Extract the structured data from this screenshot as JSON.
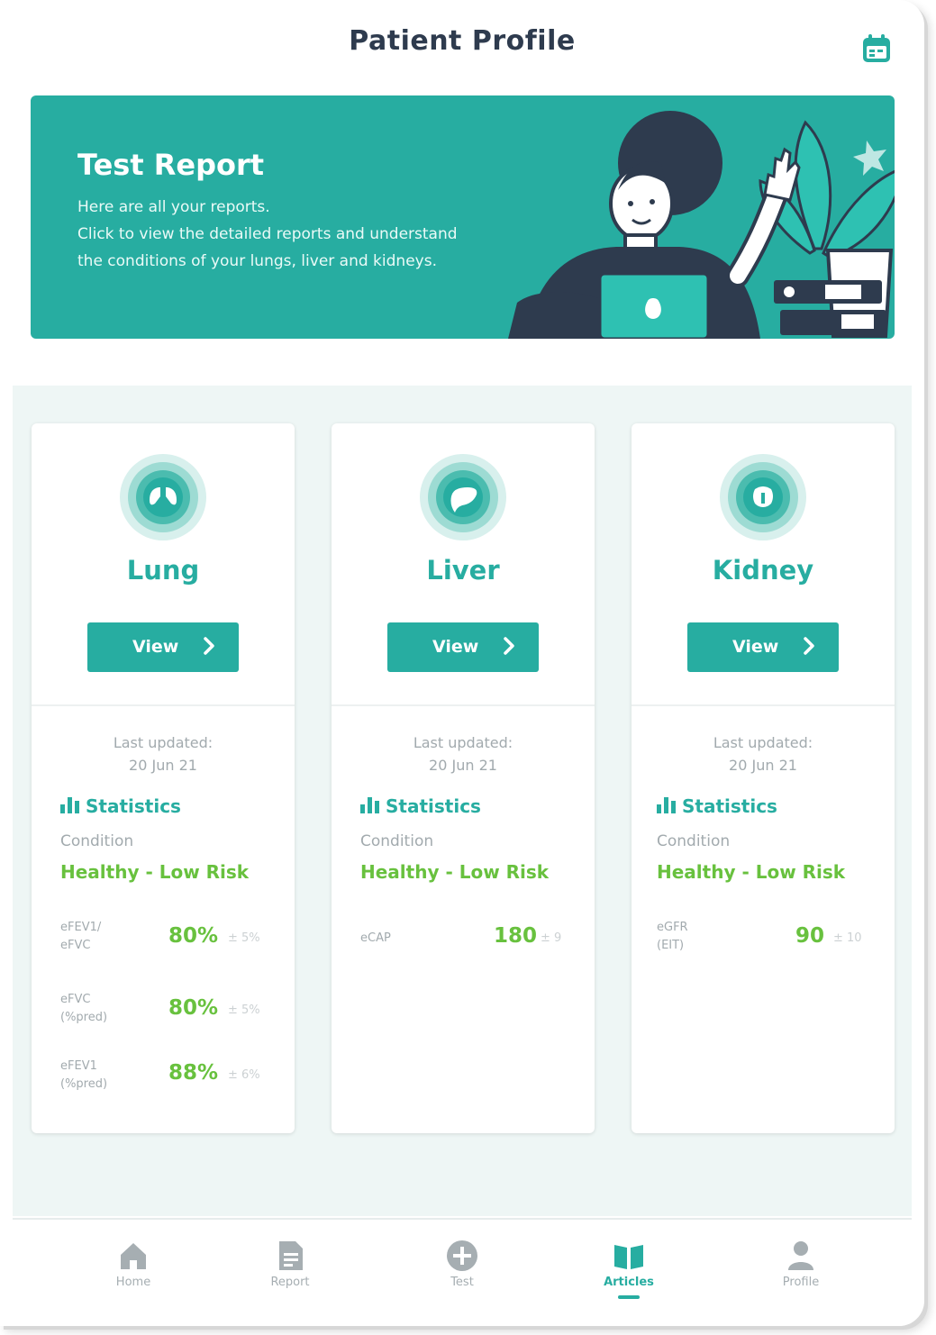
{
  "header": {
    "title": "Patient Profile"
  },
  "banner": {
    "title": "Test Report",
    "line1": "Here are all your reports.",
    "line2": "Click to view the detailed reports and understand",
    "line3": "the conditions of your lungs, liver and kidneys."
  },
  "colors": {
    "accent": "#27ada1",
    "good": "#68c13e",
    "muted": "#a2aaae",
    "dark": "#2e3b4e"
  },
  "cards": [
    {
      "name": "Lung",
      "icon": "lungs-icon",
      "button": "View",
      "updated_label": "Last updated:",
      "updated_date": "20 Jun 21",
      "stats_label": "Statistics",
      "condition_label": "Condition",
      "condition": "Healthy - Low Risk",
      "metrics": [
        {
          "l1": "eFEV1/",
          "l2": "eFVC",
          "value": "80%",
          "tol": "± 5%"
        },
        {
          "l1": "eFVC",
          "l2": "(%pred)",
          "value": "80%",
          "tol": "± 5%"
        },
        {
          "l1": "eFEV1",
          "l2": "(%pred)",
          "value": "88%",
          "tol": "± 6%"
        }
      ]
    },
    {
      "name": "Liver",
      "icon": "liver-icon",
      "button": "View",
      "updated_label": "Last updated:",
      "updated_date": "20 Jun 21",
      "stats_label": "Statistics",
      "condition_label": "Condition",
      "condition": "Healthy - Low Risk",
      "metrics": [
        {
          "l1": "eCAP",
          "l2": "",
          "value": "180",
          "tol": "± 9"
        }
      ]
    },
    {
      "name": "Kidney",
      "icon": "kidney-icon",
      "button": "View",
      "updated_label": "Last updated:",
      "updated_date": "20 Jun 21",
      "stats_label": "Statistics",
      "condition_label": "Condition",
      "condition": "Healthy - Low Risk",
      "metrics": [
        {
          "l1": "eGFR",
          "l2": "(EIT)",
          "value": "90",
          "tol": "± 10"
        }
      ]
    }
  ],
  "nav": [
    {
      "label": "Home",
      "icon": "home-icon"
    },
    {
      "label": "Report",
      "icon": "document-icon"
    },
    {
      "label": "Test",
      "icon": "plus-circle-icon"
    },
    {
      "label": "Articles",
      "icon": "open-book-icon",
      "active": true
    },
    {
      "label": "Profile",
      "icon": "person-icon"
    }
  ]
}
